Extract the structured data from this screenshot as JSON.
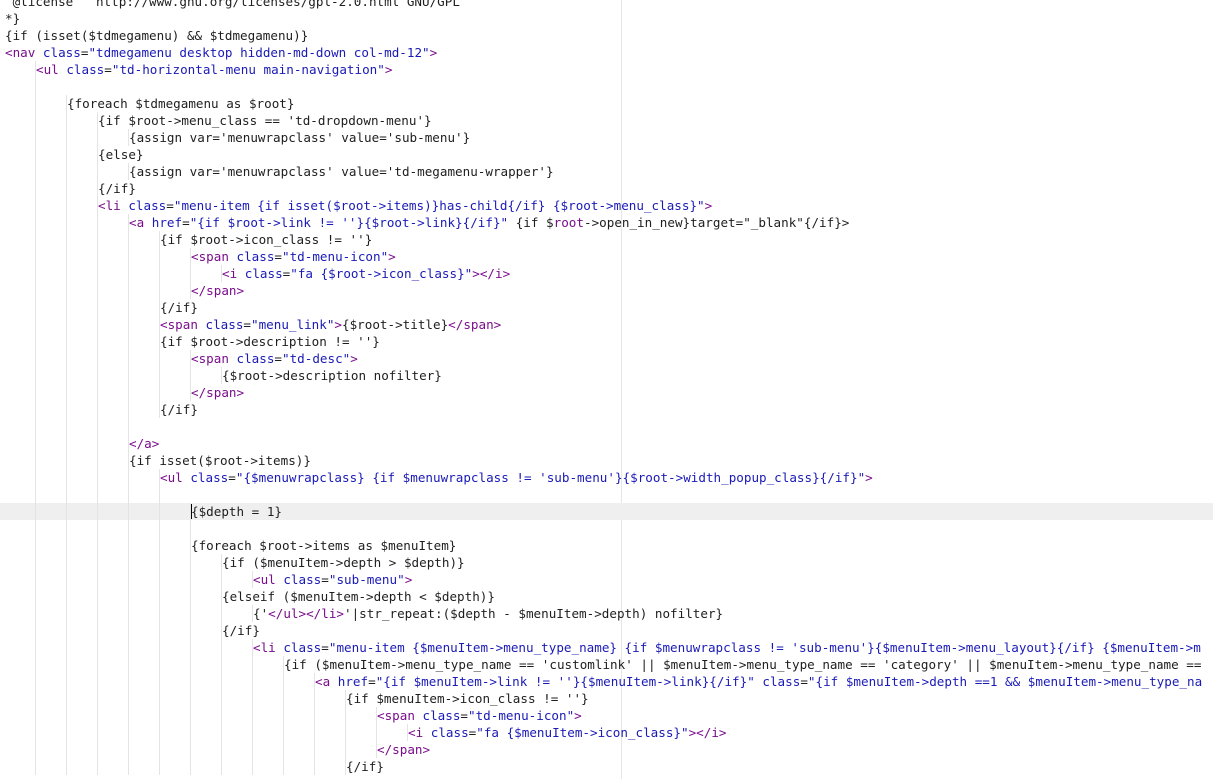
{
  "editor": {
    "current_line": 30,
    "colors": {
      "background": "#ffffff",
      "text": "#1e1e1e",
      "tag": "#7a0d8c",
      "attribute": "#1a1ab6",
      "current_line": "#efefef",
      "indent_guide": "#e4e4e4"
    },
    "lines": [
      {
        "i": 0,
        "t": [
          [
            "x",
            " @license   http://www.gnu.org/licenses/gpl-2.0.html GNU/GPL"
          ]
        ]
      },
      {
        "i": 0,
        "t": [
          [
            "x",
            "*}"
          ]
        ]
      },
      {
        "i": 0,
        "t": [
          [
            "x",
            "{if (isset($tdmegamenu) && $tdmegamenu)}"
          ]
        ]
      },
      {
        "i": 0,
        "t": [
          [
            "g",
            "<nav "
          ],
          [
            "a",
            "class"
          ],
          [
            "x",
            "="
          ],
          [
            "s",
            "\"tdmegamenu desktop hidden-md-down col-md-12\""
          ],
          [
            "g",
            ">"
          ]
        ]
      },
      {
        "i": 1,
        "t": [
          [
            "g",
            "<ul "
          ],
          [
            "a",
            "class"
          ],
          [
            "x",
            "="
          ],
          [
            "s",
            "\"td-horizontal-menu main-navigation\""
          ],
          [
            "g",
            ">"
          ]
        ]
      },
      {
        "i": 0,
        "t": []
      },
      {
        "i": 2,
        "t": [
          [
            "x",
            "{foreach $tdmegamenu as $root}"
          ]
        ]
      },
      {
        "i": 3,
        "t": [
          [
            "x",
            "{if $root->menu_class == 'td-dropdown-menu'}"
          ]
        ]
      },
      {
        "i": 4,
        "t": [
          [
            "x",
            "{assign var='menuwrapclass' value='sub-menu'}"
          ]
        ]
      },
      {
        "i": 3,
        "t": [
          [
            "x",
            "{else}"
          ]
        ]
      },
      {
        "i": 4,
        "t": [
          [
            "x",
            "{assign var='menuwrapclass' value='td-megamenu-wrapper'}"
          ]
        ]
      },
      {
        "i": 3,
        "t": [
          [
            "x",
            "{/if}"
          ]
        ]
      },
      {
        "i": 3,
        "t": [
          [
            "g",
            "<li "
          ],
          [
            "a",
            "class"
          ],
          [
            "x",
            "="
          ],
          [
            "s",
            "\"menu-item {if isset($root->items)}has-child{/if} {$root->menu_class}\""
          ],
          [
            "g",
            ">"
          ]
        ]
      },
      {
        "i": 4,
        "t": [
          [
            "g",
            "<a "
          ],
          [
            "a",
            "href"
          ],
          [
            "x",
            "="
          ],
          [
            "s",
            "\"{if $root->link != ''}{$root->link}{/if}\""
          ],
          [
            "x",
            " {if $"
          ],
          [
            "g",
            "root"
          ],
          [
            "x",
            "->open_in_new}target=\"_blank\"{/if}>"
          ]
        ]
      },
      {
        "i": 5,
        "t": [
          [
            "x",
            "{if $root->icon_class != ''}"
          ]
        ]
      },
      {
        "i": 6,
        "t": [
          [
            "g",
            "<span "
          ],
          [
            "a",
            "class"
          ],
          [
            "x",
            "="
          ],
          [
            "s",
            "\"td-menu-icon\""
          ],
          [
            "g",
            ">"
          ]
        ]
      },
      {
        "i": 7,
        "t": [
          [
            "g",
            "<i "
          ],
          [
            "a",
            "class"
          ],
          [
            "x",
            "="
          ],
          [
            "s",
            "\"fa {$root->icon_class}\""
          ],
          [
            "g",
            "></i>"
          ]
        ]
      },
      {
        "i": 6,
        "t": [
          [
            "g",
            "</span>"
          ]
        ]
      },
      {
        "i": 5,
        "t": [
          [
            "x",
            "{/if}"
          ]
        ]
      },
      {
        "i": 5,
        "t": [
          [
            "g",
            "<span "
          ],
          [
            "a",
            "class"
          ],
          [
            "x",
            "="
          ],
          [
            "s",
            "\"menu_link\""
          ],
          [
            "g",
            ">"
          ],
          [
            "x",
            "{$root->title}"
          ],
          [
            "g",
            "</span>"
          ]
        ]
      },
      {
        "i": 5,
        "t": [
          [
            "x",
            "{if $root->description != ''}"
          ]
        ]
      },
      {
        "i": 6,
        "t": [
          [
            "g",
            "<span "
          ],
          [
            "a",
            "class"
          ],
          [
            "x",
            "="
          ],
          [
            "s",
            "\"td-desc\""
          ],
          [
            "g",
            ">"
          ]
        ]
      },
      {
        "i": 7,
        "t": [
          [
            "x",
            "{$root->description nofilter}"
          ]
        ]
      },
      {
        "i": 6,
        "t": [
          [
            "g",
            "</span>"
          ]
        ]
      },
      {
        "i": 5,
        "t": [
          [
            "x",
            "{/if}"
          ]
        ]
      },
      {
        "i": 0,
        "t": []
      },
      {
        "i": 4,
        "t": [
          [
            "g",
            "</a>"
          ]
        ]
      },
      {
        "i": 4,
        "t": [
          [
            "x",
            "{if isset($root->items)}"
          ]
        ]
      },
      {
        "i": 5,
        "t": [
          [
            "g",
            "<ul "
          ],
          [
            "a",
            "class"
          ],
          [
            "x",
            "="
          ],
          [
            "s",
            "\"{$menuwrapclass} {if $menuwrapclass != 'sub-menu'}{$root->width_popup_class}{/if}\""
          ],
          [
            "g",
            ">"
          ]
        ]
      },
      {
        "i": 0,
        "t": []
      },
      {
        "i": 6,
        "t": [
          [
            "x",
            "{$depth = 1}"
          ]
        ]
      },
      {
        "i": 0,
        "t": []
      },
      {
        "i": 6,
        "t": [
          [
            "x",
            "{foreach $root->items as $menuItem}"
          ]
        ]
      },
      {
        "i": 7,
        "t": [
          [
            "x",
            "{if ($menuItem->depth > $depth)}"
          ]
        ]
      },
      {
        "i": 8,
        "t": [
          [
            "g",
            "<ul "
          ],
          [
            "a",
            "class"
          ],
          [
            "x",
            "="
          ],
          [
            "s",
            "\"sub-menu\""
          ],
          [
            "g",
            ">"
          ]
        ]
      },
      {
        "i": 7,
        "t": [
          [
            "x",
            "{elseif ($menuItem->depth < $depth)}"
          ]
        ]
      },
      {
        "i": 8,
        "t": [
          [
            "x",
            "{'"
          ],
          [
            "g",
            "</ul></li>"
          ],
          [
            "x",
            "'|str_repeat:($depth - $menuItem->depth) nofilter}"
          ]
        ]
      },
      {
        "i": 7,
        "t": [
          [
            "x",
            "{/if}"
          ]
        ]
      },
      {
        "i": 8,
        "t": [
          [
            "g",
            "<li "
          ],
          [
            "a",
            "class"
          ],
          [
            "x",
            "="
          ],
          [
            "s",
            "\"menu-item {$menuItem->menu_type_name} {if $menuwrapclass != 'sub-menu'}{$menuItem->menu_layout}{/if} {$menuItem->m"
          ]
        ]
      },
      {
        "i": 9,
        "t": [
          [
            "x",
            "{if ($menuItem->menu_type_name == 'customlink' || $menuItem->menu_type_name == 'category' || $menuItem->menu_type_name =="
          ]
        ]
      },
      {
        "i": 10,
        "t": [
          [
            "g",
            "<a "
          ],
          [
            "a",
            "href"
          ],
          [
            "x",
            "="
          ],
          [
            "s",
            "\"{if $menuItem->link != ''}{$menuItem->link}{/if}\""
          ],
          [
            "x",
            " "
          ],
          [
            "a",
            "class"
          ],
          [
            "x",
            "="
          ],
          [
            "s",
            "\"{if $menuItem->depth ==1 && $menuItem->menu_type_na"
          ]
        ]
      },
      {
        "i": 11,
        "t": [
          [
            "x",
            "{if $menuItem->icon_class != ''}"
          ]
        ]
      },
      {
        "i": 12,
        "t": [
          [
            "g",
            "<span "
          ],
          [
            "a",
            "class"
          ],
          [
            "x",
            "="
          ],
          [
            "s",
            "\"td-menu-icon\""
          ],
          [
            "g",
            ">"
          ]
        ]
      },
      {
        "i": 13,
        "t": [
          [
            "g",
            "<i "
          ],
          [
            "a",
            "class"
          ],
          [
            "x",
            "="
          ],
          [
            "s",
            "\"fa {$menuItem->icon_class}\""
          ],
          [
            "g",
            "></i>"
          ]
        ]
      },
      {
        "i": 12,
        "t": [
          [
            "g",
            "</span>"
          ]
        ]
      },
      {
        "i": 11,
        "t": [
          [
            "x",
            "{/if}"
          ]
        ]
      }
    ]
  }
}
